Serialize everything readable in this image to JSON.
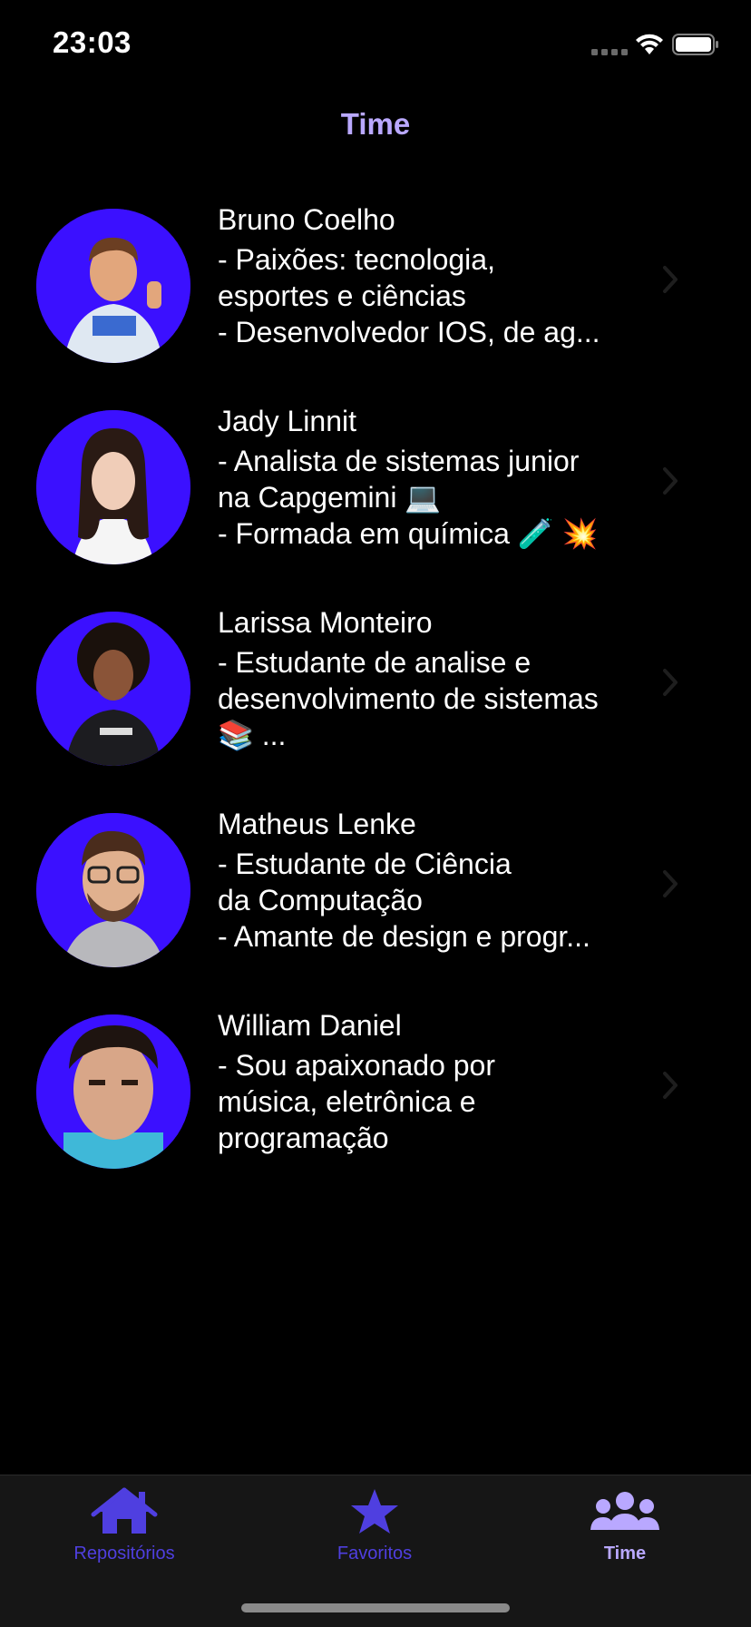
{
  "status_bar": {
    "time": "23:03"
  },
  "nav": {
    "title": "Time"
  },
  "members": [
    {
      "name": "Bruno Coelho",
      "bio_lines": [
        "- Paixões: tecnologia,",
        "esportes e ciências",
        "- Desenvolvedor IOS, de ag..."
      ]
    },
    {
      "name": "Jady Linnit",
      "bio_lines": [
        "- Analista de sistemas junior",
        "na Capgemini 💻",
        "- Formada em química 🧪 💥"
      ]
    },
    {
      "name": "Larissa Monteiro",
      "bio_lines": [
        "- Estudante de analise e",
        "desenvolvimento de sistemas",
        "📚 ..."
      ]
    },
    {
      "name": "Matheus Lenke",
      "bio_lines": [
        "- Estudante de Ciência",
        "da Computação",
        "- Amante de design e progr..."
      ]
    },
    {
      "name": "William Daniel",
      "bio_lines": [
        "- Sou apaixonado por",
        "música, eletrônica e",
        "programação"
      ]
    }
  ],
  "tab_bar": {
    "tabs": [
      {
        "label": "Repositórios",
        "icon": "house-icon",
        "active": false
      },
      {
        "label": "Favoritos",
        "icon": "star-icon",
        "active": false
      },
      {
        "label": "Time",
        "icon": "people-icon",
        "active": true
      }
    ]
  },
  "colors": {
    "background": "#000000",
    "accent": "#b9a8ff",
    "tab_inactive": "#4f3fe0",
    "avatar_bg": "#3b10ff",
    "tab_bar_bg": "#161616"
  }
}
